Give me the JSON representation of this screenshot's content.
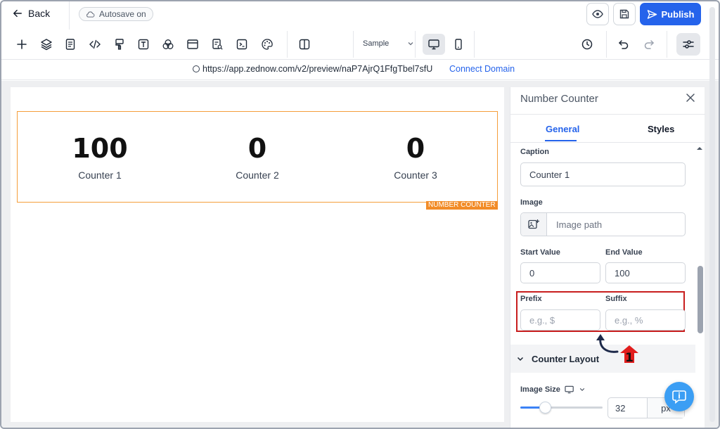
{
  "topbar": {
    "back_label": "Back",
    "autosave_label": "Autosave on",
    "publish_label": "Publish"
  },
  "toolbar": {
    "tools": [
      "plus-icon",
      "layers-icon",
      "page-icon",
      "code-icon",
      "brush-icon",
      "text-icon",
      "shapes-icon",
      "window-icon",
      "form-icon",
      "terminal-icon",
      "palette-icon",
      "columns-icon"
    ],
    "template_select": "Sample"
  },
  "urlbar": {
    "url": "https://app.zednow.com/v2/preview/naP7AjrQ1FfgTbel7sfU",
    "connect_label": "Connect Domain"
  },
  "canvas": {
    "counters": [
      {
        "value": "100",
        "caption": "Counter 1"
      },
      {
        "value": "0",
        "caption": "Counter 2"
      },
      {
        "value": "0",
        "caption": "Counter 3"
      }
    ],
    "component_tag": "NUMBER COUNTER"
  },
  "panel": {
    "title": "Number Counter",
    "tabs": {
      "general": "General",
      "styles": "Styles"
    },
    "caption": {
      "label": "Caption",
      "value": "Counter 1"
    },
    "image": {
      "label": "Image",
      "placeholder": "Image path"
    },
    "start_value": {
      "label": "Start Value",
      "value": "0"
    },
    "end_value": {
      "label": "End Value",
      "value": "100"
    },
    "prefix": {
      "label": "Prefix",
      "placeholder": "e.g., $"
    },
    "suffix": {
      "label": "Suffix",
      "placeholder": "e.g., %"
    },
    "counter_layout_label": "Counter Layout",
    "image_size": {
      "label": "Image Size",
      "value": "32",
      "unit": "px",
      "slider_fraction": 0.3
    }
  },
  "annotation": {
    "badge": "1"
  },
  "colors": {
    "accent": "#2563eb",
    "highlight": "#c81e1e",
    "counter_border": "#f59e3b"
  }
}
